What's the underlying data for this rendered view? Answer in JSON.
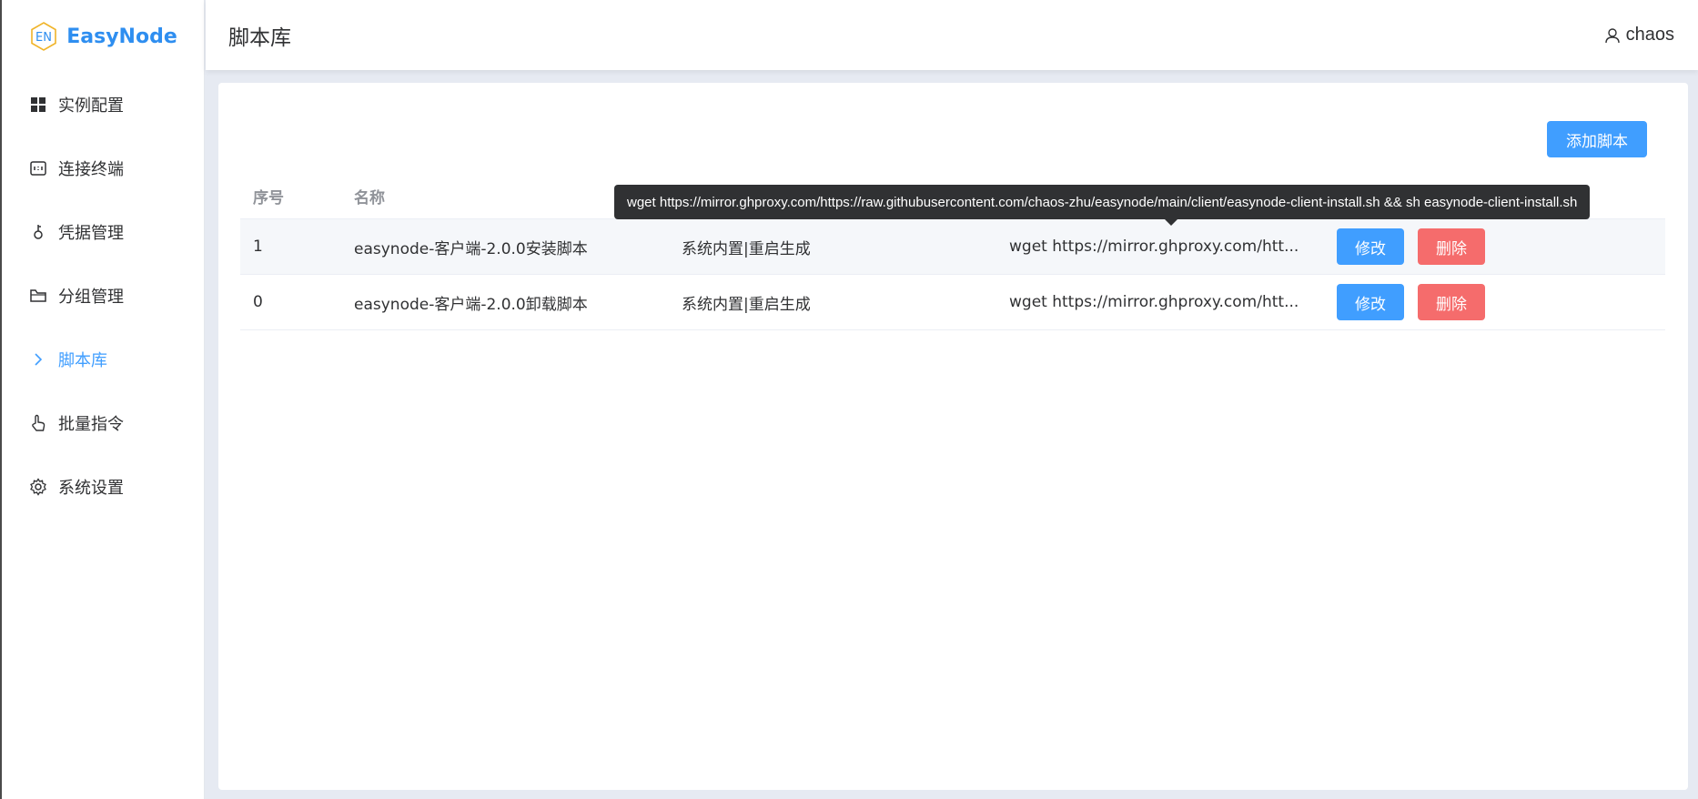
{
  "app": {
    "logo_mark": "EN",
    "name": "EasyNode",
    "brand_color": "#2e8ef0",
    "accent_color": "#409eff",
    "danger_color": "#f56c6c"
  },
  "sidebar": {
    "items": [
      {
        "label": "实例配置",
        "icon": "grid-icon"
      },
      {
        "label": "连接终端",
        "icon": "terminal-icon"
      },
      {
        "label": "凭据管理",
        "icon": "key-icon"
      },
      {
        "label": "分组管理",
        "icon": "folder-icon"
      },
      {
        "label": "脚本库",
        "icon": "chevron-right-icon",
        "active": true
      },
      {
        "label": "批量指令",
        "icon": "pointer-icon"
      },
      {
        "label": "系统设置",
        "icon": "gear-icon"
      }
    ]
  },
  "header": {
    "title": "脚本库",
    "username": "chaos"
  },
  "main": {
    "add_button": "添加脚本",
    "columns": [
      "序号",
      "名称"
    ],
    "rows": [
      {
        "index": "1",
        "name": "easynode-客户端-2.0.0安装脚本",
        "description": "系统内置|重启生成",
        "command": "wget https://mirror.ghproxy.com/htt...",
        "edit": "修改",
        "delete": "删除"
      },
      {
        "index": "0",
        "name": "easynode-客户端-2.0.0卸载脚本",
        "description": "系统内置|重启生成",
        "command": "wget https://mirror.ghproxy.com/htt...",
        "edit": "修改",
        "delete": "删除"
      }
    ],
    "tooltip": "wget https://mirror.ghproxy.com/https://raw.githubusercontent.com/chaos-zhu/easynode/main/client/easynode-client-install.sh && sh easynode-client-install.sh"
  }
}
